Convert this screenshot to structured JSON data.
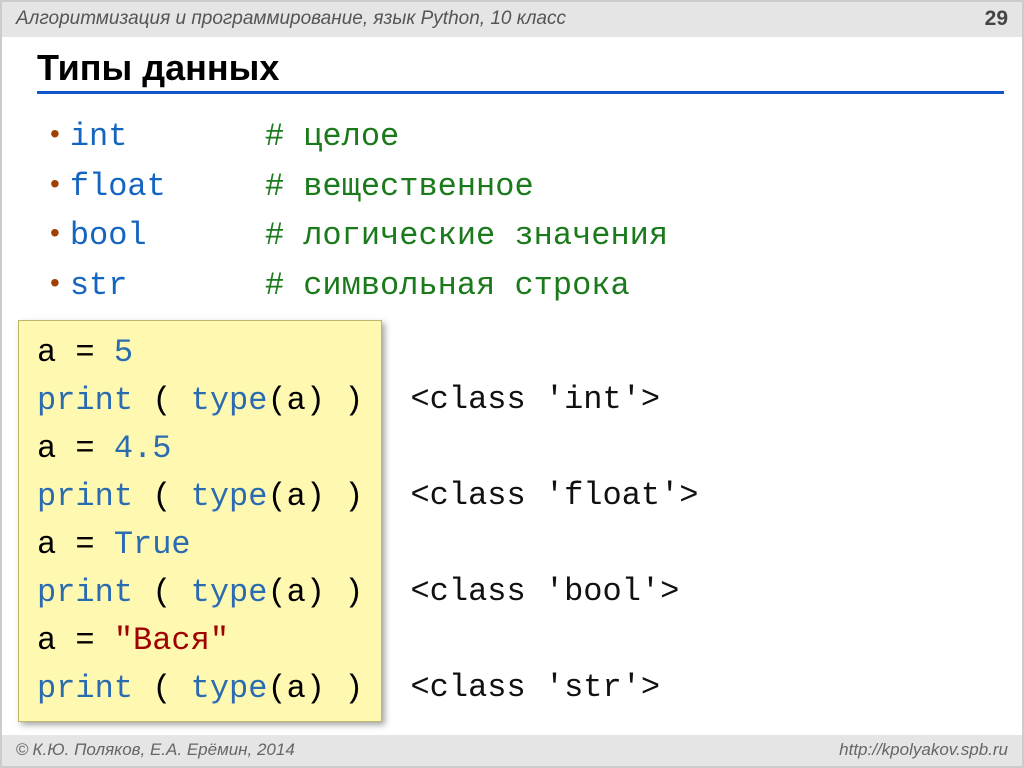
{
  "header": {
    "subject": "Алгоритмизация и программирование, язык Python, 10 класс",
    "page_number": "29"
  },
  "title": "Типы данных",
  "types": [
    {
      "name": "int",
      "comment": "# целое"
    },
    {
      "name": "float",
      "comment": "# вещественное"
    },
    {
      "name": "bool",
      "comment": "# логические значения"
    },
    {
      "name": "str",
      "comment": "# символьная строка"
    }
  ],
  "code": {
    "l1a": "a",
    "l1b": "=",
    "l1c": "5",
    "l2a": "print",
    "l2b": "( ",
    "l2c": "type",
    "l2d": "(a) )",
    "l3a": "a",
    "l3b": "=",
    "l3c": "4.5",
    "l4a": "print",
    "l4b": "( ",
    "l4c": "type",
    "l4d": "(a) )",
    "l5a": "a",
    "l5b": "=",
    "l5c": "True",
    "l6a": "print",
    "l6b": "( ",
    "l6c": "type",
    "l6d": "(a) )",
    "l7a": "a",
    "l7b": "=",
    "l7c": "\"Вася\"",
    "l8a": "print",
    "l8b": "( ",
    "l8c": "type",
    "l8d": "(a) )"
  },
  "outputs": {
    "o1": "<class 'int'>",
    "o2": "<class 'float'>",
    "o3": "<class 'bool'>",
    "o4": "<class 'str'>"
  },
  "footer": {
    "copyright": "К.Ю. Поляков, Е.А. Ерёмин, 2014",
    "url": "http://kpolyakov.spb.ru"
  }
}
